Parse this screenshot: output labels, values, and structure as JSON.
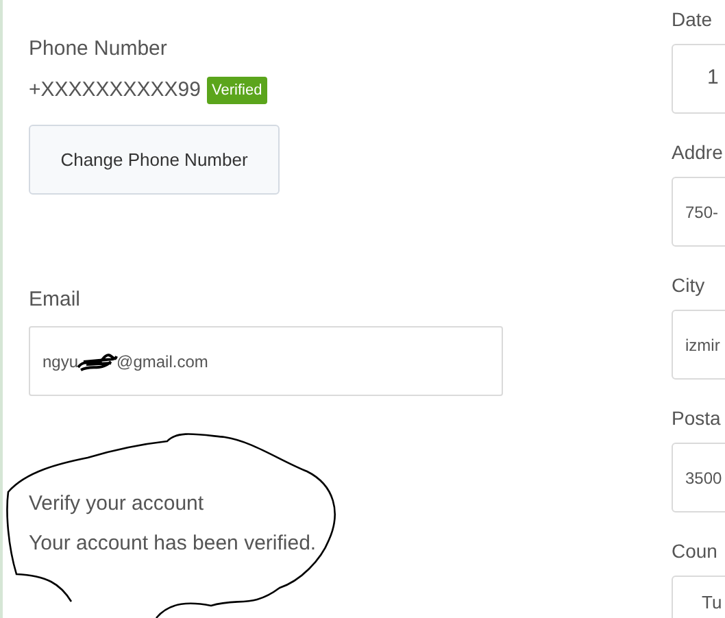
{
  "phone": {
    "label": "Phone Number",
    "number": "+XXXXXXXXXX99",
    "badge": "Verified",
    "button": "Change Phone Number"
  },
  "email": {
    "label": "Email",
    "value_start": "ngyu",
    "value_end": "@gmail.com"
  },
  "verify": {
    "title": "Verify your account",
    "message": "Your account has been verified."
  },
  "right_fields": [
    {
      "label": "Date",
      "value": "1",
      "kind": "date"
    },
    {
      "label": "Addre",
      "value": "750-",
      "kind": "text"
    },
    {
      "label": "City",
      "value": "izmir",
      "kind": "text"
    },
    {
      "label": "Posta",
      "value": "3500",
      "kind": "text"
    },
    {
      "label": "Coun",
      "value": "Tu",
      "kind": "select"
    }
  ]
}
